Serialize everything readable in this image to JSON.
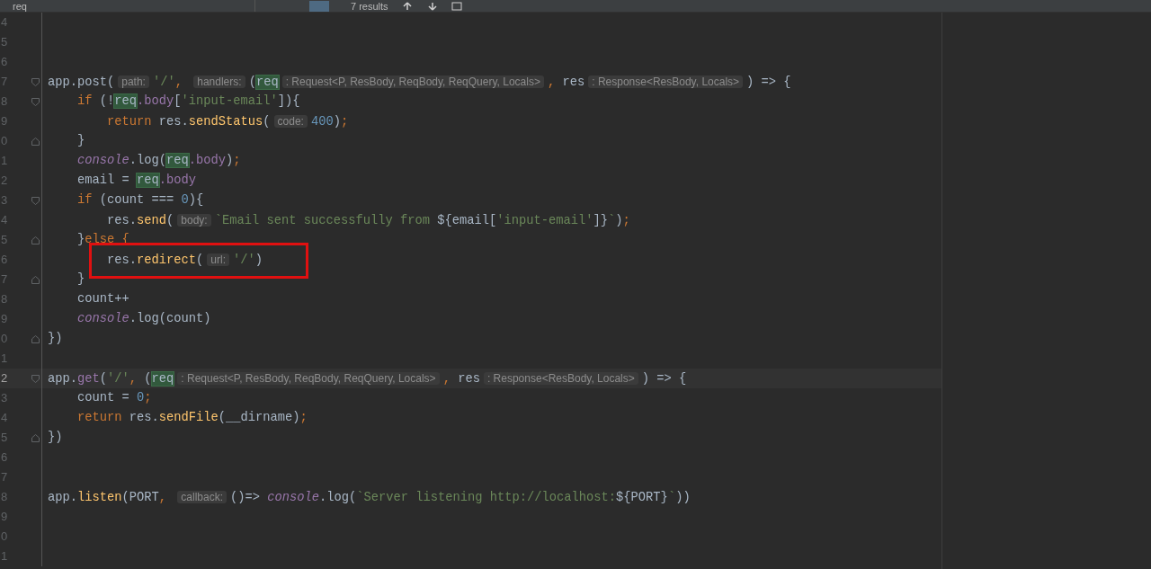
{
  "find_bar": {
    "query": "req",
    "match_count": "7 results"
  },
  "editor": {
    "lines": [
      {
        "number": "4"
      },
      {
        "number": "5"
      },
      {
        "number": "6"
      },
      {
        "number": "7",
        "fold_start": true,
        "tokens": [
          {
            "text": "app.post(",
            "kind": "plain"
          },
          {
            "text": "path:",
            "kind": "hint"
          },
          {
            "text": "'/'",
            "kind": "string"
          },
          {
            "text": ", ",
            "kind": "punct"
          },
          {
            "text": "handlers:",
            "kind": "hint"
          },
          {
            "text": "(",
            "kind": "plain"
          },
          {
            "text": "req",
            "kind": "match"
          },
          {
            "text": ": Request<P, ResBody, ReqBody, ReqQuery, Locals>",
            "kind": "hint"
          },
          {
            "text": ", ",
            "kind": "punct"
          },
          {
            "text": "res",
            "kind": "plain"
          },
          {
            "text": ": Response<ResBody, Locals>",
            "kind": "hint"
          },
          {
            "text": ") => {",
            "kind": "plain"
          }
        ]
      },
      {
        "number": "8",
        "fold_start": true,
        "tokens": [
          {
            "text": "    if",
            "kind": "keyword"
          },
          {
            "text": " (!",
            "kind": "plain"
          },
          {
            "text": "req",
            "kind": "match"
          },
          {
            "text": ".body",
            "kind": "property"
          },
          {
            "text": "[",
            "kind": "plain"
          },
          {
            "text": "'input-email'",
            "kind": "string"
          },
          {
            "text": "]){",
            "kind": "plain"
          }
        ]
      },
      {
        "number": "9",
        "tokens": [
          {
            "text": "        return",
            "kind": "keyword"
          },
          {
            "text": " res.",
            "kind": "plain"
          },
          {
            "text": "sendStatus",
            "kind": "method"
          },
          {
            "text": "(",
            "kind": "plain"
          },
          {
            "text": "code:",
            "kind": "hint"
          },
          {
            "text": "400",
            "kind": "number"
          },
          {
            "text": ")",
            "kind": "plain"
          },
          {
            "text": ";",
            "kind": "punct"
          }
        ]
      },
      {
        "number": "0",
        "fold_end": true,
        "tokens": [
          {
            "text": "    }",
            "kind": "plain"
          }
        ]
      },
      {
        "number": "1",
        "tokens": [
          {
            "text": "    console",
            "kind": "global"
          },
          {
            "text": ".log(",
            "kind": "plain"
          },
          {
            "text": "req",
            "kind": "match"
          },
          {
            "text": ".body",
            "kind": "property"
          },
          {
            "text": ")",
            "kind": "plain"
          },
          {
            "text": ";",
            "kind": "punct"
          }
        ]
      },
      {
        "number": "2",
        "tokens": [
          {
            "text": "    email = ",
            "kind": "plain"
          },
          {
            "text": "req",
            "kind": "match"
          },
          {
            "text": ".body",
            "kind": "property"
          }
        ]
      },
      {
        "number": "3",
        "fold_start": true,
        "tokens": [
          {
            "text": "    if",
            "kind": "keyword"
          },
          {
            "text": " (count === ",
            "kind": "plain"
          },
          {
            "text": "0",
            "kind": "number"
          },
          {
            "text": "){",
            "kind": "plain"
          }
        ]
      },
      {
        "number": "4",
        "tokens": [
          {
            "text": "        res.",
            "kind": "plain"
          },
          {
            "text": "send",
            "kind": "method"
          },
          {
            "text": "(",
            "kind": "plain"
          },
          {
            "text": "body:",
            "kind": "hint"
          },
          {
            "text": "`Email sent successfully from ",
            "kind": "string"
          },
          {
            "text": "${email[",
            "kind": "plain"
          },
          {
            "text": "'input-email'",
            "kind": "string"
          },
          {
            "text": "]}",
            "kind": "plain"
          },
          {
            "text": "`",
            "kind": "string"
          },
          {
            "text": ")",
            "kind": "plain"
          },
          {
            "text": ";",
            "kind": "punct"
          }
        ]
      },
      {
        "number": "5",
        "fold_end": true,
        "tokens": [
          {
            "text": "    }",
            "kind": "plain"
          },
          {
            "text": "else {",
            "kind": "keyword"
          }
        ]
      },
      {
        "number": "6",
        "boxed": true,
        "tokens": [
          {
            "text": "        res.",
            "kind": "plain"
          },
          {
            "text": "redirect",
            "kind": "method"
          },
          {
            "text": "(",
            "kind": "plain"
          },
          {
            "text": "url:",
            "kind": "hint"
          },
          {
            "text": "'/'",
            "kind": "string"
          },
          {
            "text": ")",
            "kind": "plain"
          }
        ]
      },
      {
        "number": "7",
        "fold_end": true,
        "tokens": [
          {
            "text": "    }",
            "kind": "plain"
          }
        ]
      },
      {
        "number": "8",
        "tokens": [
          {
            "text": "    count++",
            "kind": "plain"
          }
        ]
      },
      {
        "number": "9",
        "tokens": [
          {
            "text": "    console",
            "kind": "global"
          },
          {
            "text": ".log(count)",
            "kind": "plain"
          }
        ]
      },
      {
        "number": "0",
        "fold_end": true,
        "tokens": [
          {
            "text": "})",
            "kind": "plain"
          }
        ]
      },
      {
        "number": "1"
      },
      {
        "number": "2",
        "current": true,
        "fold_start": true,
        "tokens": [
          {
            "text": "app.",
            "kind": "plain"
          },
          {
            "text": "get",
            "kind": "property"
          },
          {
            "text": "(",
            "kind": "plain"
          },
          {
            "text": "'/'",
            "kind": "string"
          },
          {
            "text": ", ",
            "kind": "punct"
          },
          {
            "text": "(",
            "kind": "plain"
          },
          {
            "text": "req",
            "kind": "match"
          },
          {
            "text": ": Request<P, ResBody, ReqBody, ReqQuery, Locals>",
            "kind": "hint"
          },
          {
            "text": ", ",
            "kind": "punct"
          },
          {
            "text": "res",
            "kind": "plain"
          },
          {
            "text": ": Response<ResBody, Locals>",
            "kind": "hint"
          },
          {
            "text": ") => {",
            "kind": "plain"
          }
        ]
      },
      {
        "number": "3",
        "tokens": [
          {
            "text": "    count = ",
            "kind": "plain"
          },
          {
            "text": "0",
            "kind": "number"
          },
          {
            "text": ";",
            "kind": "punct"
          }
        ]
      },
      {
        "number": "4",
        "tokens": [
          {
            "text": "    return",
            "kind": "keyword"
          },
          {
            "text": " res.",
            "kind": "plain"
          },
          {
            "text": "sendFile",
            "kind": "method"
          },
          {
            "text": "(__dirname)",
            "kind": "plain"
          },
          {
            "text": ";",
            "kind": "punct"
          }
        ]
      },
      {
        "number": "5",
        "fold_end": true,
        "tokens": [
          {
            "text": "})",
            "kind": "plain"
          }
        ]
      },
      {
        "number": "6"
      },
      {
        "number": "7"
      },
      {
        "number": "8",
        "tokens": [
          {
            "text": "app.",
            "kind": "plain"
          },
          {
            "text": "listen",
            "kind": "method"
          },
          {
            "text": "(PORT",
            "kind": "plain"
          },
          {
            "text": ", ",
            "kind": "punct"
          },
          {
            "text": "callback:",
            "kind": "hint"
          },
          {
            "text": "()=> ",
            "kind": "plain"
          },
          {
            "text": "console",
            "kind": "global"
          },
          {
            "text": ".log(",
            "kind": "plain"
          },
          {
            "text": "`Server listening http://localhost:",
            "kind": "string"
          },
          {
            "text": "${PORT}",
            "kind": "plain"
          },
          {
            "text": "`",
            "kind": "string"
          },
          {
            "text": "))",
            "kind": "plain"
          }
        ]
      },
      {
        "number": "9"
      },
      {
        "number": "0"
      },
      {
        "number": "1"
      }
    ]
  }
}
